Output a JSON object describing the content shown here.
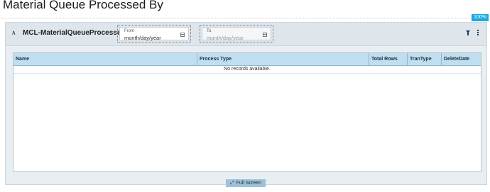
{
  "page": {
    "title": "Material Queue Processed By",
    "zoom": "100%"
  },
  "panel": {
    "title": "MCL-MaterialQueueProcessedBy",
    "from": {
      "label": "From",
      "placeholder": "month/day/year"
    },
    "to": {
      "label": "To",
      "placeholder": "month/day/year"
    },
    "icons": {
      "collapse": "chevron-up-icon",
      "filter": "filter-icon",
      "more": "more-vertical-icon",
      "calendar": "calendar-icon"
    }
  },
  "grid": {
    "columns": [
      "Name",
      "Process Type",
      "Total Rows",
      "TranType",
      "DeleteDate"
    ],
    "empty_text": "No records available."
  },
  "footer": {
    "fullscreen_label": "Full Screen",
    "icon": "expand-icon"
  },
  "colors": {
    "accent": "#19a9e0",
    "grid_header": "#bfdff0",
    "panel_bg": "#e9eef2"
  }
}
